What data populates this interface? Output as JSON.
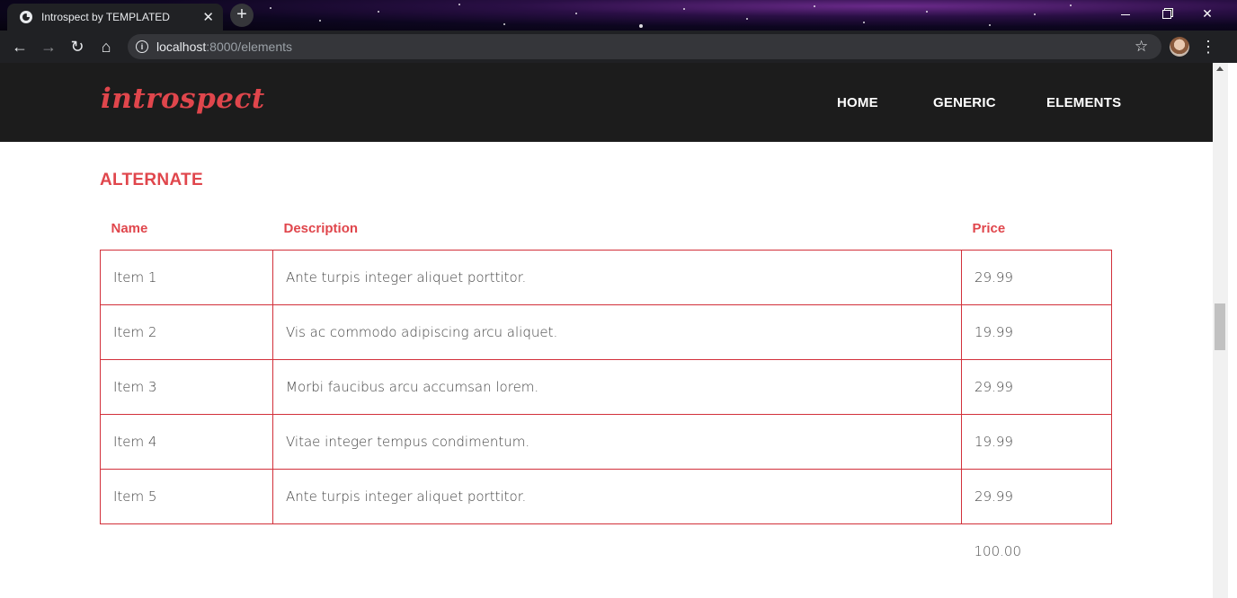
{
  "browser": {
    "tab_title": "Introspect by TEMPLATED",
    "tab_close": "✕",
    "new_tab": "+",
    "url_host": "localhost",
    "url_path": ":8000/elements",
    "icons": [
      "back-icon",
      "forward-icon",
      "reload-icon",
      "home-icon",
      "info-icon",
      "bookmark-star-icon",
      "profile-avatar",
      "menu-kebab-icon"
    ]
  },
  "site": {
    "logo": "introspect",
    "nav": [
      "HOME",
      "GENERIC",
      "ELEMENTS"
    ],
    "accent_color": "#e0464c",
    "header_bg": "#1c1c1c"
  },
  "section": {
    "title": "ALTERNATE"
  },
  "table": {
    "headers": [
      "Name",
      "Description",
      "Price"
    ],
    "rows": [
      {
        "name": "Item 1",
        "description": "Ante turpis integer aliquet porttitor.",
        "price": "29.99"
      },
      {
        "name": "Item 2",
        "description": "Vis ac commodo adipiscing arcu aliquet.",
        "price": "19.99"
      },
      {
        "name": "Item 3",
        "description": "Morbi faucibus arcu accumsan lorem.",
        "price": "29.99"
      },
      {
        "name": "Item 4",
        "description": "Vitae integer tempus condimentum.",
        "price": "19.99"
      },
      {
        "name": "Item 5",
        "description": "Ante turpis integer aliquet porttitor.",
        "price": "29.99"
      }
    ],
    "total": "100.00"
  }
}
